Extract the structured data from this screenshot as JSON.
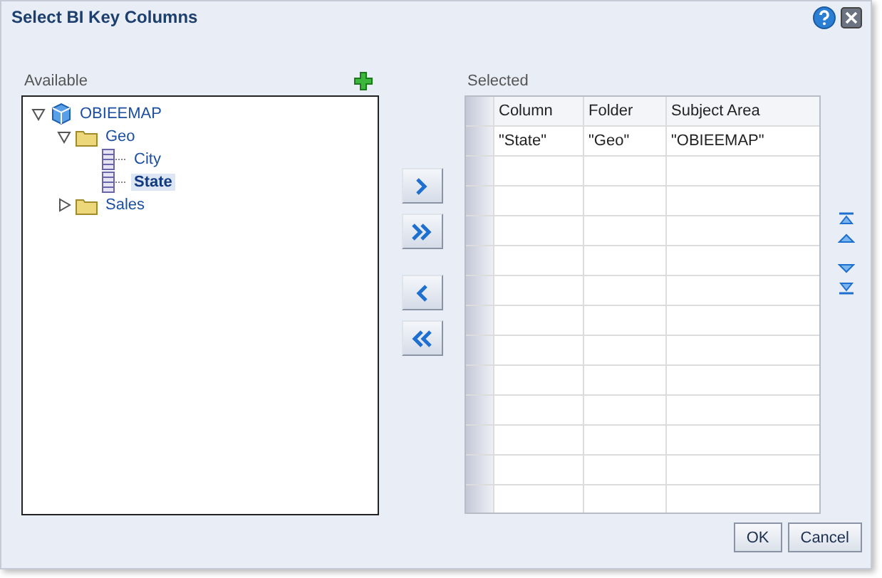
{
  "window": {
    "title": "Select BI Key Columns"
  },
  "available": {
    "label": "Available",
    "tree": [
      {
        "label": "OBIEEMAP",
        "kind": "model",
        "expanded": true,
        "selected": false,
        "children": [
          {
            "label": "Geo",
            "kind": "folder",
            "expanded": true,
            "selected": false,
            "children": [
              {
                "label": "City",
                "kind": "column",
                "selected": false
              },
              {
                "label": "State",
                "kind": "column",
                "selected": true
              }
            ]
          },
          {
            "label": "Sales",
            "kind": "folder",
            "expanded": false,
            "selected": false
          }
        ]
      }
    ]
  },
  "selected": {
    "label": "Selected",
    "columns": [
      "Column",
      "Folder",
      "Subject Area"
    ],
    "rows": [
      [
        "\"State\"",
        "\"Geo\"",
        "\"OBIEEMAP\""
      ]
    ]
  },
  "buttons": [
    "OK",
    "Cancel"
  ]
}
